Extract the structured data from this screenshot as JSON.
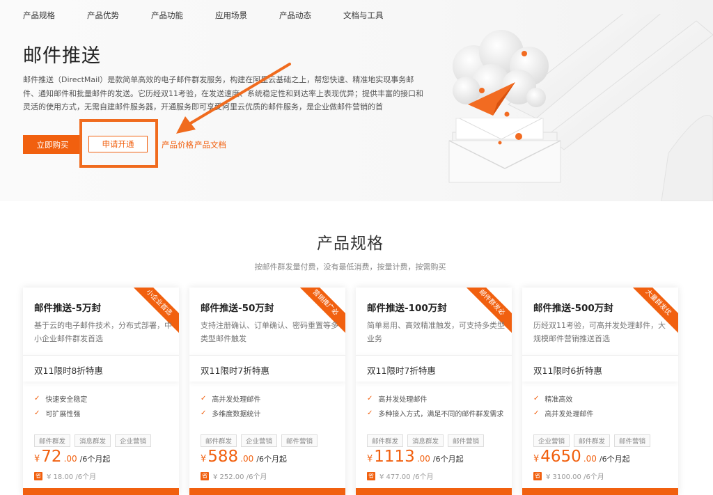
{
  "nav": [
    "产品规格",
    "产品优势",
    "产品功能",
    "应用场景",
    "产品动态",
    "文档与工具"
  ],
  "hero": {
    "title": "邮件推送",
    "description": "邮件推送（DirectMail）是款简单高效的电子邮件群发服务，构建在阿里云基础之上，帮您快速、精准地实现事务邮件、通知邮件和批量邮件的发送。它历经双11考验，在发送速度、系统稳定性和到达率上表现优异；提供丰富的接口和灵活的使用方式，无需自建邮件服务器，开通服务即可享受阿里云优质的邮件服务，是企业做邮件营销的首",
    "buy_button": "立即购买",
    "apply_button": "申请开通",
    "price_link": "产品价格",
    "doc_link": "产品文档"
  },
  "section": {
    "title": "产品规格",
    "subtitle": "按邮件群发量付费，没有最低消费，按量计费，按需购买"
  },
  "cards": [
    {
      "name": "邮件推送-5万封",
      "ribbon": "小企业首选",
      "desc": "基于云的电子邮件技术，分布式部署，中小企业邮件群发首选",
      "promo": "双11限时8折特惠",
      "features": [
        "快速安全稳定",
        "可扩展性强"
      ],
      "tags": [
        "邮件群发",
        "消息群发",
        "企业营销"
      ],
      "currency": "¥",
      "price_int": "72",
      "price_dec": ".00",
      "unit": "/6个月起",
      "orig_badge": "省",
      "orig": "¥ 18.00 /6个月"
    },
    {
      "name": "邮件推送-50万封",
      "ribbon": "营销推广必",
      "desc": "支持注册确认、订单确认、密码重置等多类型邮件触发",
      "promo": "双11限时7折特惠",
      "features": [
        "高并发处理邮件",
        "多维度数据统计"
      ],
      "tags": [
        "邮件群发",
        "企业营销",
        "邮件营销"
      ],
      "currency": "¥",
      "price_int": "588",
      "price_dec": ".00",
      "unit": "/6个月起",
      "orig_badge": "省",
      "orig": "¥ 252.00 /6个月"
    },
    {
      "name": "邮件推送-100万封",
      "ribbon": "邮件群发必",
      "desc": "简单易用、高效精准触发，可支持多类型业务",
      "promo": "双11限时7折特惠",
      "features": [
        "高并发处理邮件",
        "多种接入方式，满足不同的邮件群发需求"
      ],
      "tags": [
        "邮件群发",
        "消息群发",
        "邮件营销"
      ],
      "currency": "¥",
      "price_int": "1113",
      "price_dec": ".00",
      "unit": "/6个月起",
      "orig_badge": "省",
      "orig": "¥ 477.00 /6个月"
    },
    {
      "name": "邮件推送-500万封",
      "ribbon": "大量群发优",
      "desc": "历经双11考验，可高并发处理邮件，大规模邮件营销推送首选",
      "promo": "双11限时6折特惠",
      "features": [
        "精准高效",
        "高并发处理邮件"
      ],
      "tags": [
        "企业营销",
        "邮件群发",
        "邮件营销"
      ],
      "currency": "¥",
      "price_int": "4650",
      "price_dec": ".00",
      "unit": "/6个月起",
      "orig_badge": "省",
      "orig": "¥ 3100.00 /6个月"
    }
  ],
  "colors": {
    "accent": "#f1600f",
    "highlight": "#f06b1e"
  }
}
